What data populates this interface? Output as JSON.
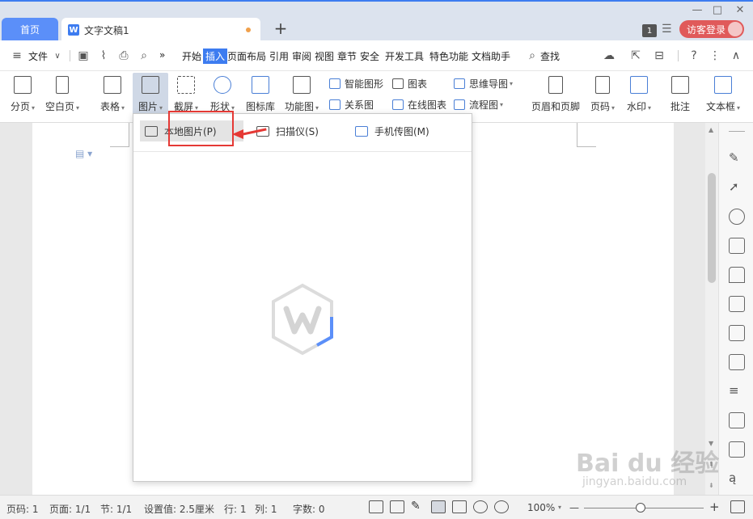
{
  "titlebar": {
    "home_tab": "首页",
    "doc_tab": "文字文稿1",
    "doc_icon_letter": "W",
    "new_tab": "+",
    "window_count": "1",
    "login": "访客登录",
    "controls": [
      "—",
      "□",
      "✕"
    ]
  },
  "menubar": {
    "file": "文件",
    "more": "»",
    "tabs": [
      "开始",
      "插入",
      "页面布局",
      "引用",
      "审阅",
      "视图",
      "章节",
      "安全",
      "开发工具",
      "特色功能",
      "文档助手"
    ],
    "active_tab": "插入",
    "search": "查找",
    "help": "?",
    "options": "⋮",
    "collapse": "∧"
  },
  "ribbon": {
    "big_buttons": [
      "分页",
      "空白页",
      "表格",
      "图片",
      "截屏",
      "形状",
      "图标库",
      "功能图",
      "页眉和页脚",
      "页码",
      "水印",
      "批注",
      "文本框"
    ],
    "small_buttons": [
      "智能图形",
      "图表",
      "思维导图",
      "关系图",
      "在线图表",
      "流程图"
    ]
  },
  "dropdown": {
    "items": [
      "本地图片(P)",
      "扫描仪(S)",
      "手机传图(M)"
    ]
  },
  "statusbar": {
    "page_num": "页码: 1",
    "pages": "页面: 1/1",
    "section": "节: 1/1",
    "setting": "设置值: 2.5厘米",
    "row": "行: 1",
    "col": "列: 1",
    "word_count": "字数: 0",
    "zoom": "100%",
    "zoom_minus": "—",
    "zoom_plus": "+",
    "zoom_level": 0.47
  },
  "watermark": {
    "main": "Bai du 经验",
    "sub": "jingyan.baidu.com"
  }
}
